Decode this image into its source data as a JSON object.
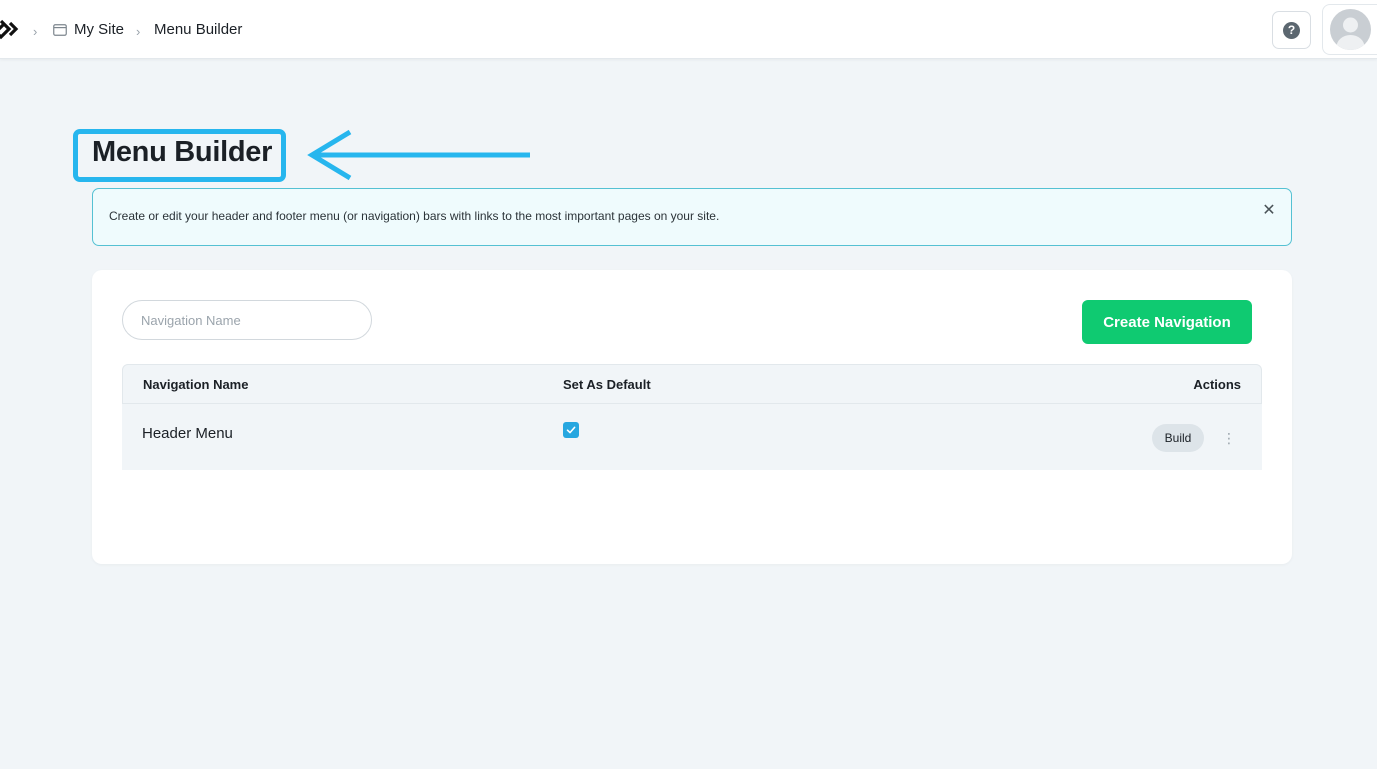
{
  "breadcrumb": {
    "site": "My Site",
    "current": "Menu Builder"
  },
  "header": {
    "help_icon": "question-circle-icon",
    "help_glyph": "?",
    "avatar_icon": "user-avatar"
  },
  "page": {
    "title": "Menu Builder"
  },
  "info_banner": {
    "text": "Create or edit your header and footer menu (or navigation) bars with links to the most important pages on your site.",
    "close_glyph": "✕"
  },
  "toolbar": {
    "search_placeholder": "Navigation Name",
    "create_label": "Create Navigation"
  },
  "table": {
    "columns": [
      "Navigation Name",
      "Set As Default",
      "Actions"
    ],
    "rows": [
      {
        "name": "Header Menu",
        "is_default": true,
        "action_label": "Build",
        "more_glyph": "⋮"
      }
    ]
  },
  "colors": {
    "accent_green": "#0fca71",
    "annotation_blue": "#27b6ee",
    "checkbox_blue": "#27a7e0",
    "banner_border": "#55c1d3"
  }
}
